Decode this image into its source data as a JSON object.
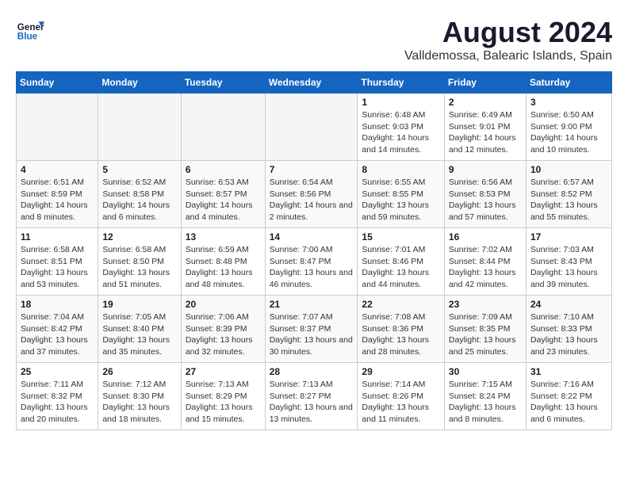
{
  "header": {
    "logo_general": "General",
    "logo_blue": "Blue",
    "month_title": "August 2024",
    "location": "Valldemossa, Balearic Islands, Spain"
  },
  "days_of_week": [
    "Sunday",
    "Monday",
    "Tuesday",
    "Wednesday",
    "Thursday",
    "Friday",
    "Saturday"
  ],
  "weeks": [
    [
      {
        "day": "",
        "content": ""
      },
      {
        "day": "",
        "content": ""
      },
      {
        "day": "",
        "content": ""
      },
      {
        "day": "",
        "content": ""
      },
      {
        "day": "1",
        "content": "Sunrise: 6:48 AM\nSunset: 9:03 PM\nDaylight: 14 hours and 14 minutes."
      },
      {
        "day": "2",
        "content": "Sunrise: 6:49 AM\nSunset: 9:01 PM\nDaylight: 14 hours and 12 minutes."
      },
      {
        "day": "3",
        "content": "Sunrise: 6:50 AM\nSunset: 9:00 PM\nDaylight: 14 hours and 10 minutes."
      }
    ],
    [
      {
        "day": "4",
        "content": "Sunrise: 6:51 AM\nSunset: 8:59 PM\nDaylight: 14 hours and 8 minutes."
      },
      {
        "day": "5",
        "content": "Sunrise: 6:52 AM\nSunset: 8:58 PM\nDaylight: 14 hours and 6 minutes."
      },
      {
        "day": "6",
        "content": "Sunrise: 6:53 AM\nSunset: 8:57 PM\nDaylight: 14 hours and 4 minutes."
      },
      {
        "day": "7",
        "content": "Sunrise: 6:54 AM\nSunset: 8:56 PM\nDaylight: 14 hours and 2 minutes."
      },
      {
        "day": "8",
        "content": "Sunrise: 6:55 AM\nSunset: 8:55 PM\nDaylight: 13 hours and 59 minutes."
      },
      {
        "day": "9",
        "content": "Sunrise: 6:56 AM\nSunset: 8:53 PM\nDaylight: 13 hours and 57 minutes."
      },
      {
        "day": "10",
        "content": "Sunrise: 6:57 AM\nSunset: 8:52 PM\nDaylight: 13 hours and 55 minutes."
      }
    ],
    [
      {
        "day": "11",
        "content": "Sunrise: 6:58 AM\nSunset: 8:51 PM\nDaylight: 13 hours and 53 minutes."
      },
      {
        "day": "12",
        "content": "Sunrise: 6:58 AM\nSunset: 8:50 PM\nDaylight: 13 hours and 51 minutes."
      },
      {
        "day": "13",
        "content": "Sunrise: 6:59 AM\nSunset: 8:48 PM\nDaylight: 13 hours and 48 minutes."
      },
      {
        "day": "14",
        "content": "Sunrise: 7:00 AM\nSunset: 8:47 PM\nDaylight: 13 hours and 46 minutes."
      },
      {
        "day": "15",
        "content": "Sunrise: 7:01 AM\nSunset: 8:46 PM\nDaylight: 13 hours and 44 minutes."
      },
      {
        "day": "16",
        "content": "Sunrise: 7:02 AM\nSunset: 8:44 PM\nDaylight: 13 hours and 42 minutes."
      },
      {
        "day": "17",
        "content": "Sunrise: 7:03 AM\nSunset: 8:43 PM\nDaylight: 13 hours and 39 minutes."
      }
    ],
    [
      {
        "day": "18",
        "content": "Sunrise: 7:04 AM\nSunset: 8:42 PM\nDaylight: 13 hours and 37 minutes."
      },
      {
        "day": "19",
        "content": "Sunrise: 7:05 AM\nSunset: 8:40 PM\nDaylight: 13 hours and 35 minutes."
      },
      {
        "day": "20",
        "content": "Sunrise: 7:06 AM\nSunset: 8:39 PM\nDaylight: 13 hours and 32 minutes."
      },
      {
        "day": "21",
        "content": "Sunrise: 7:07 AM\nSunset: 8:37 PM\nDaylight: 13 hours and 30 minutes."
      },
      {
        "day": "22",
        "content": "Sunrise: 7:08 AM\nSunset: 8:36 PM\nDaylight: 13 hours and 28 minutes."
      },
      {
        "day": "23",
        "content": "Sunrise: 7:09 AM\nSunset: 8:35 PM\nDaylight: 13 hours and 25 minutes."
      },
      {
        "day": "24",
        "content": "Sunrise: 7:10 AM\nSunset: 8:33 PM\nDaylight: 13 hours and 23 minutes."
      }
    ],
    [
      {
        "day": "25",
        "content": "Sunrise: 7:11 AM\nSunset: 8:32 PM\nDaylight: 13 hours and 20 minutes."
      },
      {
        "day": "26",
        "content": "Sunrise: 7:12 AM\nSunset: 8:30 PM\nDaylight: 13 hours and 18 minutes."
      },
      {
        "day": "27",
        "content": "Sunrise: 7:13 AM\nSunset: 8:29 PM\nDaylight: 13 hours and 15 minutes."
      },
      {
        "day": "28",
        "content": "Sunrise: 7:13 AM\nSunset: 8:27 PM\nDaylight: 13 hours and 13 minutes."
      },
      {
        "day": "29",
        "content": "Sunrise: 7:14 AM\nSunset: 8:26 PM\nDaylight: 13 hours and 11 minutes."
      },
      {
        "day": "30",
        "content": "Sunrise: 7:15 AM\nSunset: 8:24 PM\nDaylight: 13 hours and 8 minutes."
      },
      {
        "day": "31",
        "content": "Sunrise: 7:16 AM\nSunset: 8:22 PM\nDaylight: 13 hours and 6 minutes."
      }
    ]
  ]
}
